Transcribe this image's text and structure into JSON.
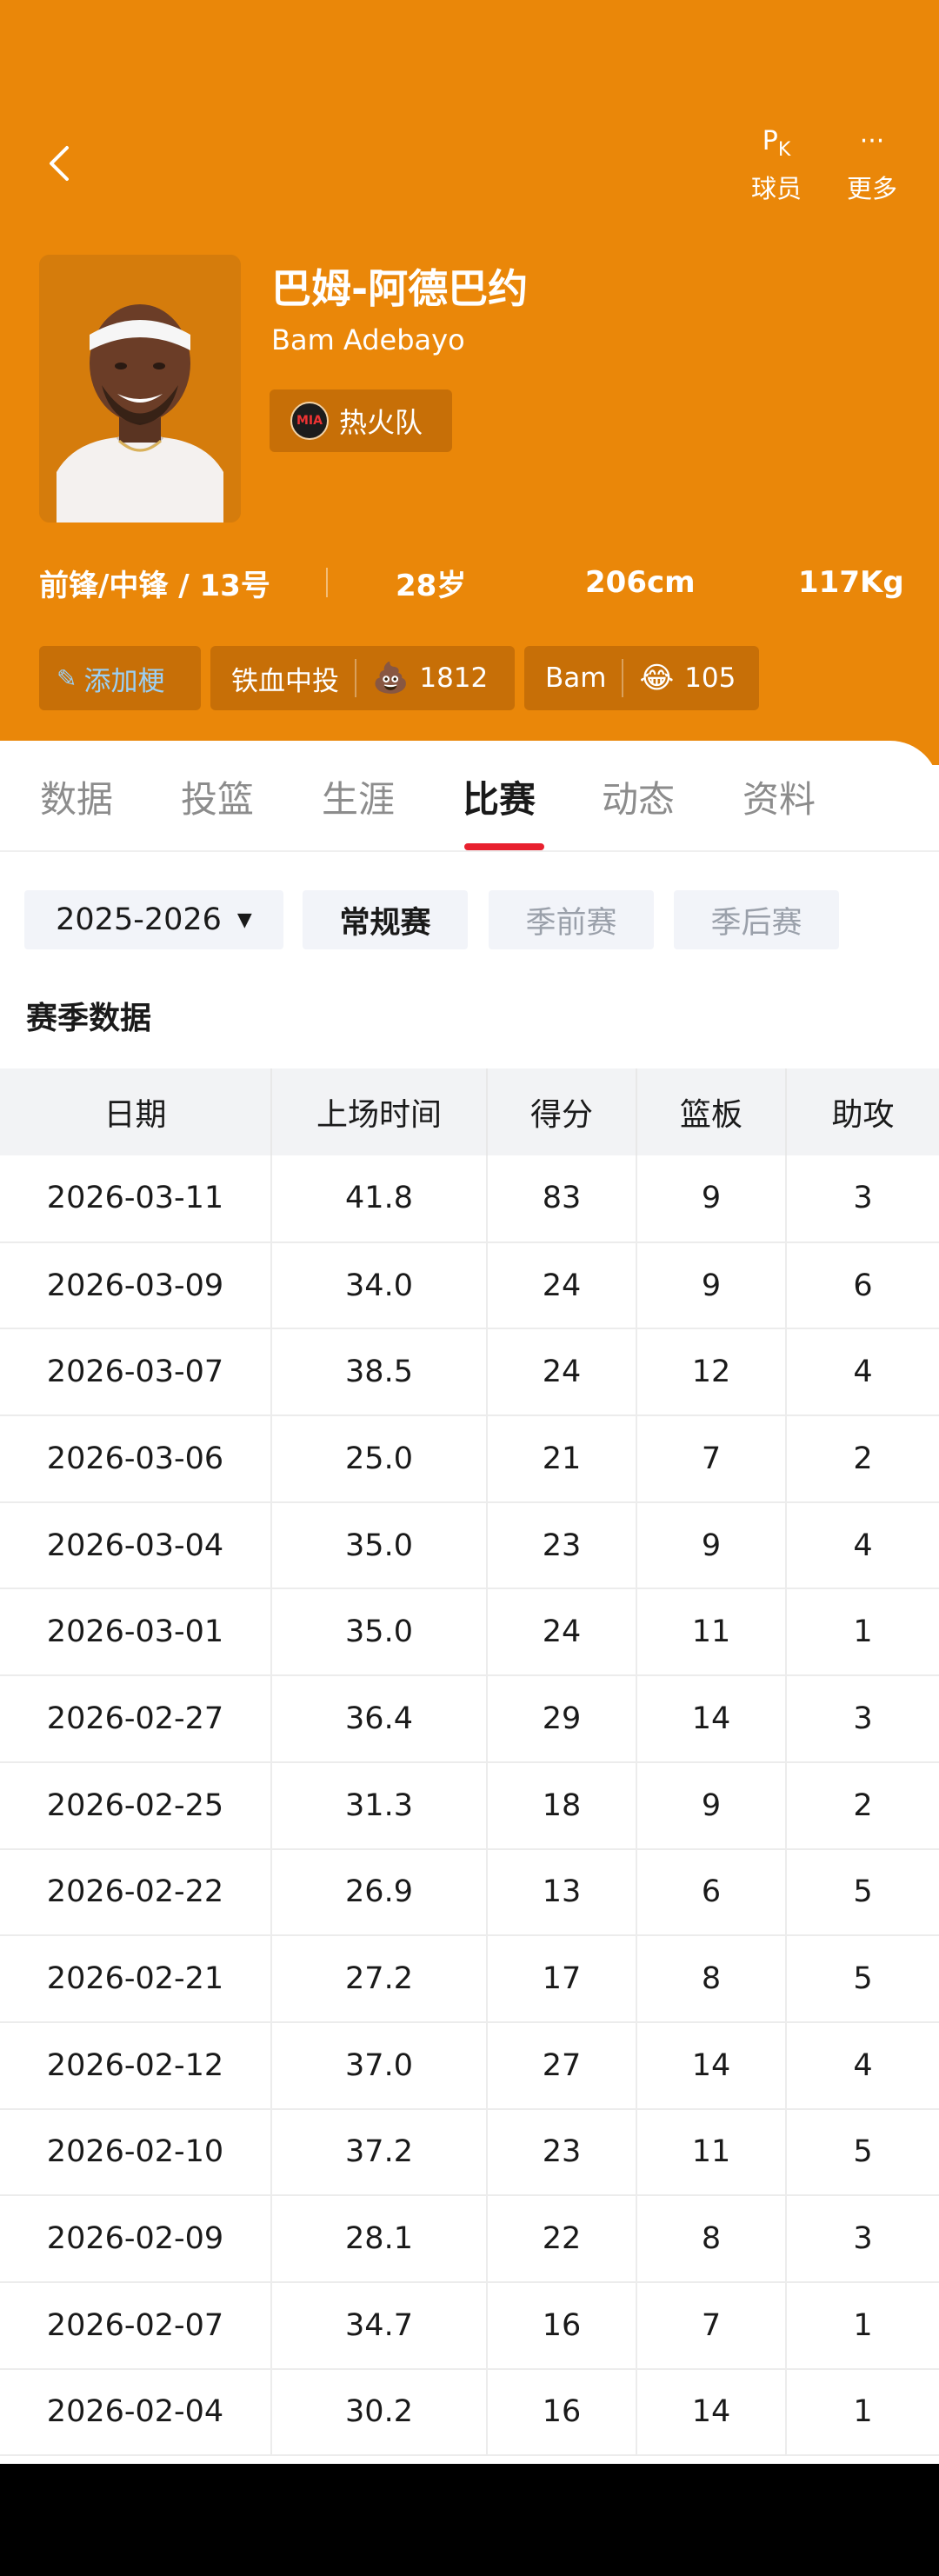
{
  "header": {
    "pk_icon": "P",
    "pk_icon_sub": "K",
    "pk_label": "球员",
    "more_icon": "···",
    "more_label": "更多"
  },
  "player": {
    "name_cn": "巴姆-阿德巴约",
    "name_en": "Bam Adebayo",
    "team": "热火队",
    "team_logo_text": "MIA",
    "position_number": "前锋/中锋 / 13号",
    "age": "28岁",
    "height": "206cm",
    "weight": "117Kg"
  },
  "chips": {
    "add_label": "添加梗",
    "tag1_label": "铁血中投",
    "tag1_emoji": "💩",
    "tag1_count": "1812",
    "tag2_label": "Bam",
    "tag2_emoji": "😂",
    "tag2_count": "105"
  },
  "tabs": [
    "数据",
    "投篮",
    "生涯",
    "比赛",
    "动态",
    "资料"
  ],
  "active_tab": "比赛",
  "filters": {
    "season": "2025-2026",
    "regular": "常规赛",
    "preseason": "季前赛",
    "postseason": "季后赛"
  },
  "section_title": "赛季数据",
  "table": {
    "headers": [
      "日期",
      "上场时间",
      "得分",
      "篮板",
      "助攻"
    ],
    "rows": [
      [
        "2026-03-11",
        "41.8",
        "83",
        "9",
        "3"
      ],
      [
        "2026-03-09",
        "34.0",
        "24",
        "9",
        "6"
      ],
      [
        "2026-03-07",
        "38.5",
        "24",
        "12",
        "4"
      ],
      [
        "2026-03-06",
        "25.0",
        "21",
        "7",
        "2"
      ],
      [
        "2026-03-04",
        "35.0",
        "23",
        "9",
        "4"
      ],
      [
        "2026-03-01",
        "35.0",
        "24",
        "11",
        "1"
      ],
      [
        "2026-02-27",
        "36.4",
        "29",
        "14",
        "3"
      ],
      [
        "2026-02-25",
        "31.3",
        "18",
        "9",
        "2"
      ],
      [
        "2026-02-22",
        "26.9",
        "13",
        "6",
        "5"
      ],
      [
        "2026-02-21",
        "27.2",
        "17",
        "8",
        "5"
      ],
      [
        "2026-02-12",
        "37.0",
        "27",
        "14",
        "4"
      ],
      [
        "2026-02-10",
        "37.2",
        "23",
        "11",
        "5"
      ],
      [
        "2026-02-09",
        "28.1",
        "22",
        "8",
        "3"
      ],
      [
        "2026-02-07",
        "34.7",
        "16",
        "7",
        "1"
      ],
      [
        "2026-02-04",
        "30.2",
        "16",
        "14",
        "1"
      ]
    ]
  },
  "colors": {
    "brand_orange": "#ea8709",
    "tag_bg": "#c76f07",
    "accent_red": "#e8202e"
  }
}
